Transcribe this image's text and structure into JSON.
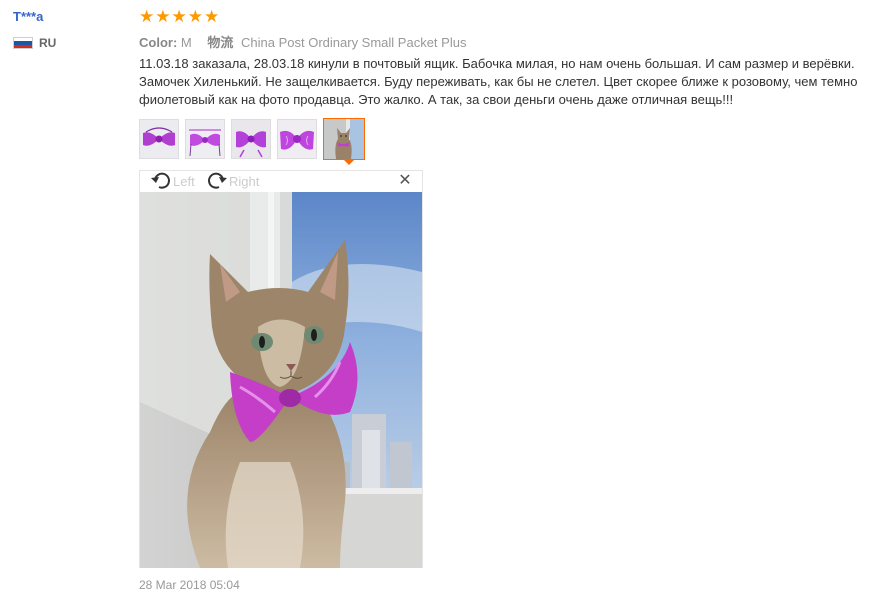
{
  "reviewer": {
    "name": "T***a",
    "country_code": "RU",
    "flag_colors": [
      "#ffffff",
      "#1c57a5",
      "#d52b1e"
    ]
  },
  "review": {
    "rating": 5,
    "star_color": "#ff9900",
    "color_label": "Color:",
    "color_value": "M",
    "logistics_label": "物流",
    "logistics_value": "China Post Ordinary Small Packet Plus",
    "text": "11.03.18 заказала, 28.03.18 кинули в почтовый ящик. Бабочка милая, но нам очень большая. И сам размер и верёвки. Замочек Хиленький. Не защелкивается. Буду переживать, как бы не слетел. Цвет скорее ближе к розовому, чем темно фиолетовый как на фото продавца. Это жалко. А так, за свои деньги очень даже отличная вещь!!!",
    "date": "28 Mar 2018 05:04"
  },
  "thumbnails": [
    {
      "icon": "bow-tie-photo",
      "active": false
    },
    {
      "icon": "bow-tie-photo",
      "active": false
    },
    {
      "icon": "bow-tie-photo",
      "active": false
    },
    {
      "icon": "bow-tie-photo",
      "active": false
    },
    {
      "icon": "cat-photo",
      "active": true
    }
  ],
  "viewer": {
    "rotate_left_label": "Left",
    "rotate_right_label": "Right",
    "close_icon": "close-icon",
    "accent_color": "#ff6a00"
  }
}
